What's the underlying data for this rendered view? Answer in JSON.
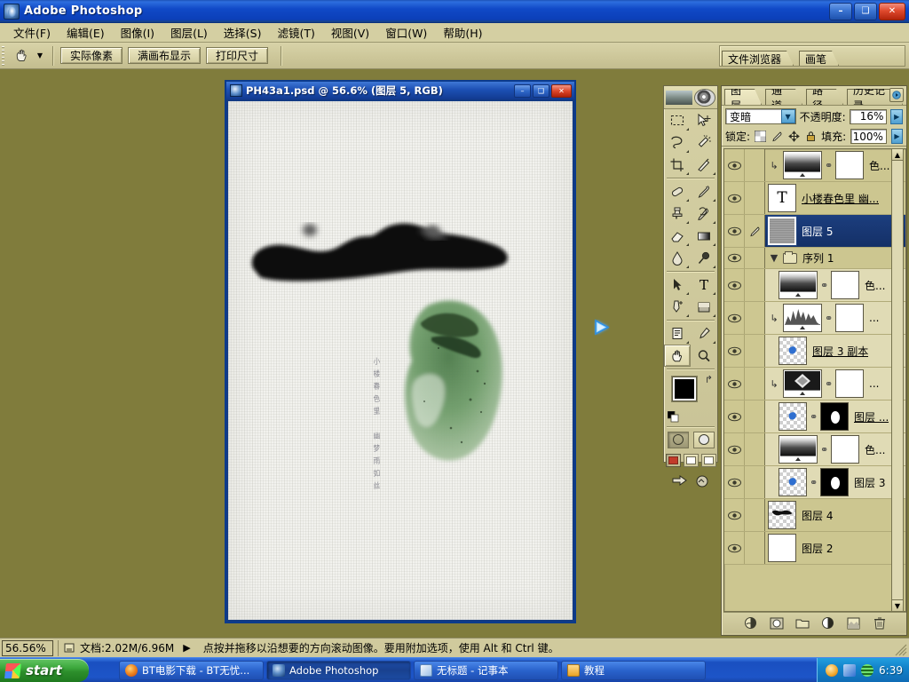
{
  "window": {
    "title": "Adobe Photoshop",
    "minimize_label": "–",
    "maximize_label": "❑",
    "close_label": "✕"
  },
  "menubar": {
    "items": [
      {
        "text": "文件(F)"
      },
      {
        "text": "编辑(E)"
      },
      {
        "text": "图像(I)"
      },
      {
        "text": "图层(L)"
      },
      {
        "text": "选择(S)"
      },
      {
        "text": "滤镜(T)"
      },
      {
        "text": "视图(V)"
      },
      {
        "text": "窗口(W)"
      },
      {
        "text": "帮助(H)"
      }
    ]
  },
  "options_bar": {
    "active_tool": "hand-tool",
    "buttons": [
      {
        "label": "实际像素"
      },
      {
        "label": "满画布显示"
      },
      {
        "label": "打印尺寸"
      }
    ],
    "palette_well": [
      {
        "label": "文件浏览器"
      },
      {
        "label": "画笔"
      }
    ]
  },
  "document": {
    "title": "PH43a1.psd @ 56.6% (图层 5, RGB)",
    "minimize_label": "–",
    "maximize_label": "❑",
    "close_label": "✕",
    "artwork": {
      "ink_color": "#0a0a0a",
      "wash_color": "#5f8f5d",
      "paper_color": "#f2f2ee",
      "calligraphy": [
        "小",
        "楼",
        "春",
        "色",
        "里",
        "幽",
        "梦",
        "雨",
        "如",
        "丝"
      ]
    }
  },
  "toolbox": {
    "tools": [
      {
        "name": "marquee-tool",
        "glyph": "▢"
      },
      {
        "name": "move-tool",
        "glyph": "➤"
      },
      {
        "name": "lasso-tool",
        "glyph": "❦"
      },
      {
        "name": "magic-wand-tool",
        "glyph": "✳"
      },
      {
        "name": "crop-tool",
        "glyph": "⌗"
      },
      {
        "name": "slice-tool",
        "glyph": "✂"
      },
      {
        "name": "healing-brush-tool",
        "glyph": "❀"
      },
      {
        "name": "brush-tool",
        "glyph": "✎"
      },
      {
        "name": "clone-stamp-tool",
        "glyph": "⚒"
      },
      {
        "name": "history-brush-tool",
        "glyph": "✐"
      },
      {
        "name": "eraser-tool",
        "glyph": "▱"
      },
      {
        "name": "gradient-tool",
        "glyph": "■"
      },
      {
        "name": "blur-tool",
        "glyph": "●"
      },
      {
        "name": "dodge-tool",
        "glyph": "⚲"
      },
      {
        "name": "path-selection-tool",
        "glyph": "➤"
      },
      {
        "name": "type-tool",
        "glyph": "T"
      },
      {
        "name": "pen-tool",
        "glyph": "✒"
      },
      {
        "name": "shape-tool",
        "glyph": "▣"
      },
      {
        "name": "notes-tool",
        "glyph": "☰"
      },
      {
        "name": "eyedropper-tool",
        "glyph": "⚗"
      },
      {
        "name": "hand-tool",
        "glyph": "✋"
      },
      {
        "name": "zoom-tool",
        "glyph": "⌕"
      }
    ],
    "foreground_color": "#000000",
    "background_color": "#ffffff",
    "swap_label": "↱",
    "quickmask": [
      "standard-mode",
      "quickmask-mode"
    ],
    "screen_modes": [
      "standard-screen",
      "full-screen-menubar",
      "full-screen"
    ],
    "jump_to": [
      "jump-to-imageready",
      "edit-in-imageready"
    ]
  },
  "layers_palette": {
    "tabs": [
      {
        "label": "图层",
        "active": true
      },
      {
        "label": "通道",
        "active": false
      },
      {
        "label": "路径",
        "active": false
      },
      {
        "label": "历史记录",
        "active": false
      }
    ],
    "menu_glyph": "▸",
    "blend_mode": "变暗",
    "opacity_label": "不透明度:",
    "opacity_value": "16%",
    "lock_label": "锁定:",
    "fill_label": "填充:",
    "fill_value": "100%",
    "lock_icons": [
      "lock-transparency",
      "lock-paint",
      "lock-position",
      "lock-all"
    ],
    "layers": [
      {
        "name": "色...",
        "type": "adjustment",
        "thumb": "gradient-map",
        "mask": "white",
        "clipped": true,
        "visible": true,
        "selected": false,
        "in_group": false,
        "underline": false
      },
      {
        "name": "小楼春色里 幽...",
        "type": "text",
        "thumb": "text",
        "mask": null,
        "clipped": false,
        "visible": true,
        "selected": false,
        "in_group": false,
        "underline": true
      },
      {
        "name": "图层 5",
        "type": "pixel",
        "thumb": "noise",
        "mask": null,
        "clipped": false,
        "visible": true,
        "selected": true,
        "in_group": false,
        "underline": false
      },
      {
        "name": "序列 1",
        "type": "group",
        "thumb": "folder",
        "mask": null,
        "clipped": false,
        "visible": true,
        "selected": false,
        "in_group": false,
        "underline": false
      },
      {
        "name": "色...",
        "type": "adjustment",
        "thumb": "gradient-map",
        "mask": "white",
        "clipped": false,
        "visible": true,
        "selected": false,
        "in_group": true,
        "underline": false
      },
      {
        "name": "...",
        "type": "adjustment",
        "thumb": "levels",
        "mask": "white",
        "clipped": true,
        "visible": true,
        "selected": false,
        "in_group": true,
        "underline": false
      },
      {
        "name": "图层 3 副本",
        "type": "pixel",
        "thumb": "blue-blob",
        "mask": null,
        "clipped": false,
        "visible": true,
        "selected": false,
        "in_group": true,
        "underline": true
      },
      {
        "name": "...",
        "type": "adjustment",
        "thumb": "diamond",
        "mask": "white",
        "clipped": true,
        "visible": true,
        "selected": false,
        "in_group": true,
        "underline": false
      },
      {
        "name": "图层 ...",
        "type": "pixel",
        "thumb": "blue-blob",
        "mask": "black",
        "clipped": false,
        "visible": true,
        "selected": false,
        "in_group": true,
        "underline": true
      },
      {
        "name": "色...",
        "type": "adjustment",
        "thumb": "gradient-map",
        "mask": "white",
        "clipped": false,
        "visible": true,
        "selected": false,
        "in_group": true,
        "underline": false
      },
      {
        "name": "图层 3",
        "type": "pixel",
        "thumb": "blue-blob",
        "mask": "black",
        "clipped": false,
        "visible": true,
        "selected": false,
        "in_group": true,
        "underline": false
      },
      {
        "name": "图层 4",
        "type": "pixel",
        "thumb": "ink-stroke",
        "mask": null,
        "clipped": false,
        "visible": true,
        "selected": false,
        "in_group": false,
        "underline": false
      },
      {
        "name": "图层 2",
        "type": "pixel",
        "thumb": "white",
        "mask": null,
        "clipped": false,
        "visible": true,
        "selected": false,
        "in_group": false,
        "underline": false
      }
    ],
    "bottom_buttons": [
      {
        "name": "layer-style-button",
        "glyph": "◑"
      },
      {
        "name": "add-layer-mask-button",
        "glyph": "◯"
      },
      {
        "name": "new-group-button",
        "glyph": "▭"
      },
      {
        "name": "new-adjustment-layer-button",
        "glyph": "◐"
      },
      {
        "name": "new-layer-button",
        "glyph": "◱"
      },
      {
        "name": "delete-layer-button",
        "glyph": "☒"
      }
    ]
  },
  "status_bar": {
    "zoom": "56.56%",
    "doc_label": "文档:2.02M/6.96M",
    "arrow": "▶",
    "hint": "点按并拖移以沿想要的方向滚动图像。要用附加选项，使用 Alt 和 Ctrl 键。"
  },
  "taskbar": {
    "start_label": "start",
    "tasks": [
      {
        "label": "BT电影下载 - BT无忧...",
        "icon": "firefox-icon",
        "active": false,
        "color": "#e8711a"
      },
      {
        "label": "Adobe Photoshop",
        "icon": "photoshop-icon",
        "active": true,
        "color": "#2c5f9e"
      },
      {
        "label": "无标题 - 记事本",
        "icon": "notepad-icon",
        "active": false,
        "color": "#dde8f5"
      },
      {
        "label": "教程",
        "icon": "folder-icon",
        "active": false,
        "color": "#f0c060"
      }
    ],
    "tray_icons": [
      "network-icon",
      "volume-icon",
      "input-method-icon"
    ],
    "clock": "6:39"
  }
}
